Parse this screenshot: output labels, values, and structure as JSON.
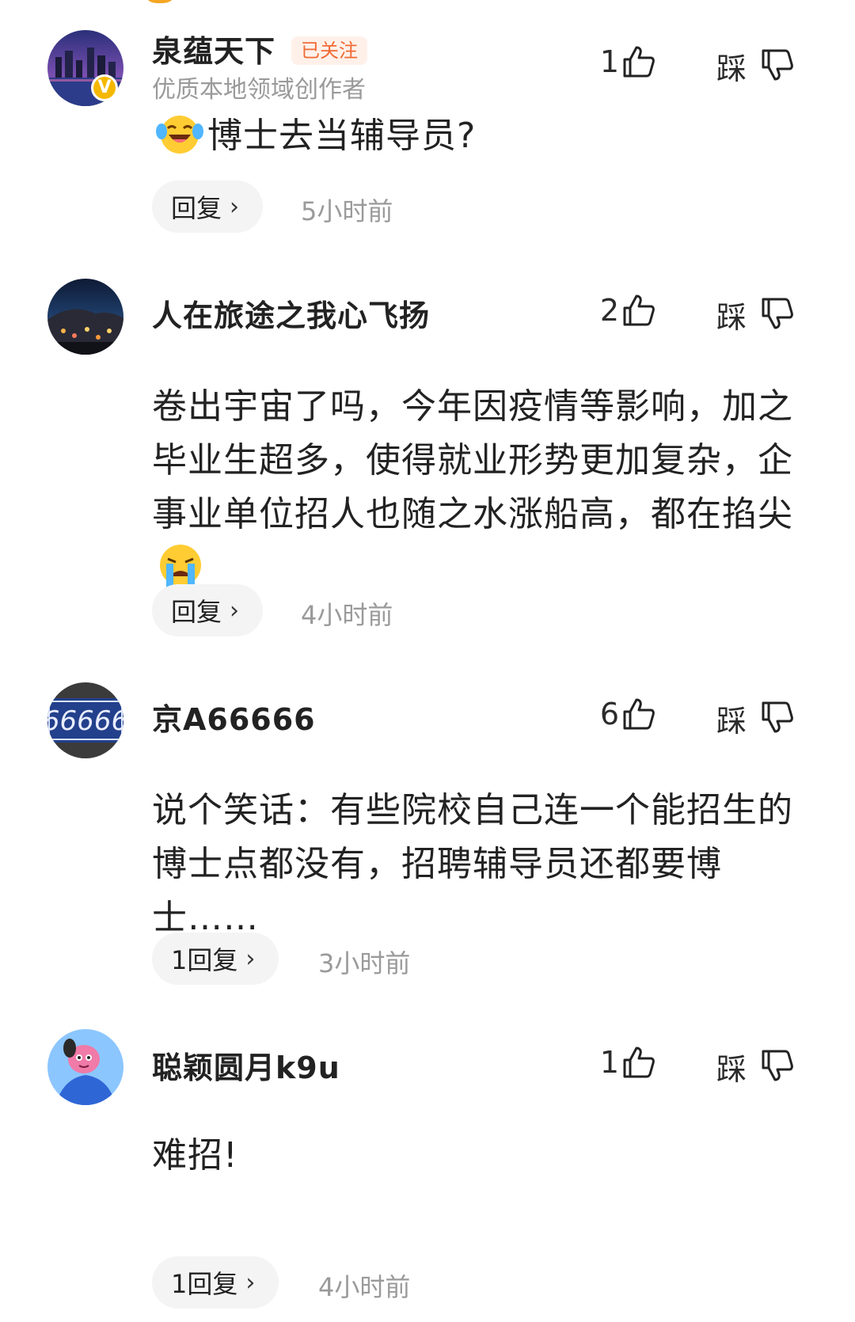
{
  "comments": [
    {
      "username": "泉蕴天下",
      "follow_tag": "已关注",
      "subtitle": "优质本地领域创作者",
      "likes": "1",
      "dislike_label": "踩",
      "content": "博士去当辅导员?",
      "reply_label": "回复",
      "time": "5小时前"
    },
    {
      "username": "人在旅途之我心飞扬",
      "likes": "2",
      "dislike_label": "踩",
      "content": "卷出宇宙了吗，今年因疫情等影响，加之毕业生超多，使得就业形势更加复杂，企事业单位招人也随之水涨船高，都在掐尖",
      "reply_label": "回复",
      "time": "4小时前"
    },
    {
      "username": "京A66666",
      "likes": "6",
      "dislike_label": "踩",
      "content": "说个笑话：有些院校自己连一个能招生的博士点都没有，招聘辅导员还都要博士……",
      "reply_label": "1回复",
      "time": "3小时前",
      "avatar_text": "66666"
    },
    {
      "username": "聪颖圆月k9u",
      "likes": "1",
      "dislike_label": "踩",
      "content": "难招!",
      "reply_label": "1回复",
      "time": "4小时前"
    }
  ],
  "icons": {
    "like": "thumbs-up-outline",
    "dislike": "thumbs-down-outline",
    "emoji_laugh_cry": "laughing-crying-face",
    "emoji_cry": "loudly-crying-face",
    "verified": "verified-v-badge"
  },
  "colors": {
    "follow_tag": "#f06a35",
    "muted_text": "#9a9a9a",
    "pill_bg": "#f4f4f4",
    "verified_badge": "#f5b800"
  }
}
